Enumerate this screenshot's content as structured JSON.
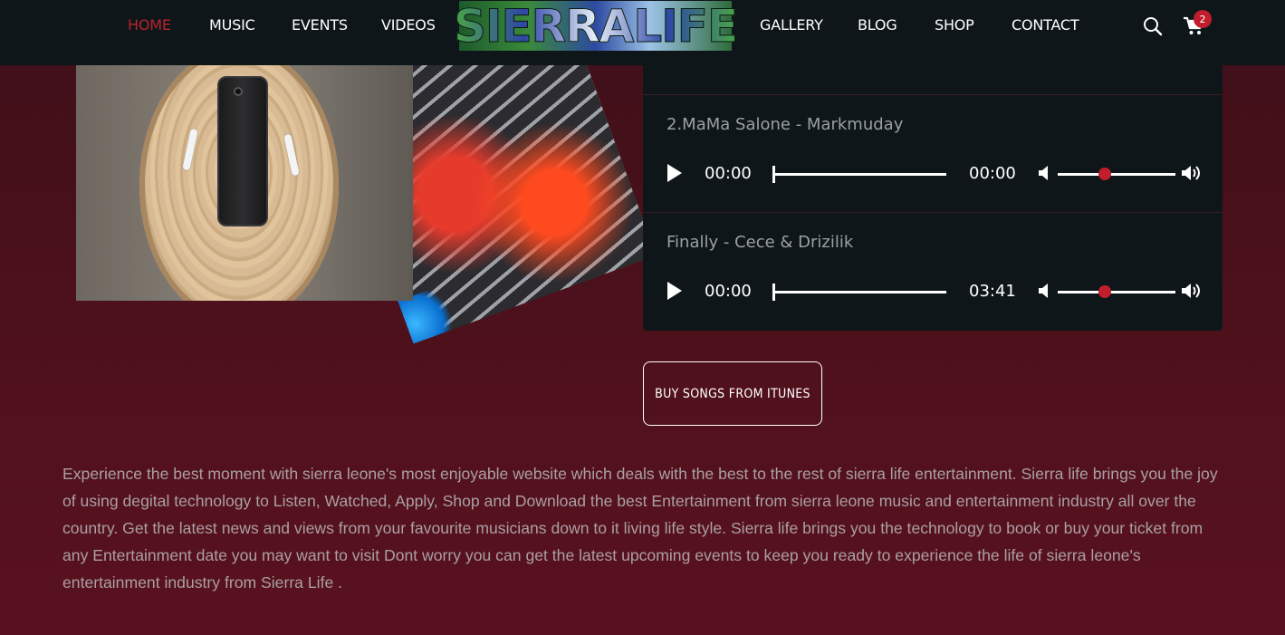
{
  "header": {
    "nav_left": [
      "HOME",
      "MUSIC",
      "EVENTS",
      "VIDEOS"
    ],
    "nav_right": [
      "GALLERY",
      "BLOG",
      "SHOP",
      "CONTACT"
    ],
    "logo_text": "SIERRALIFE",
    "cart_count": "2",
    "active_color": "#b8232f"
  },
  "playlist": {
    "tracks": [
      {
        "title": "2.MaMa Salone - Markmuday",
        "current": "00:00",
        "duration": "00:00",
        "volume": 0.4
      },
      {
        "title": "Finally - Cece & Drizilik",
        "current": "00:00",
        "duration": "03:41",
        "volume": 0.4
      }
    ]
  },
  "cta": {
    "label": "BUY SONGS FROM ITUNES"
  },
  "description": "Experience the best moment with sierra leone's most enjoyable website which deals with the best to the rest of sierra life entertainment. Sierra life brings you the joy of using degital technology to Listen, Watched, Apply, Shop and Download the best Entertainment from sierra leone music and entertainment industry all over the country. Get the latest news and views from your favourite musicians down to it living life style. Sierra life brings you the technology to book or buy your ticket from any Entertainment date you may want to visit Dont worry you can get the latest upcoming events to keep you ready to experience the life of sierra leone's entertainment industry from Sierra Life .",
  "icons": {
    "search": "search-icon",
    "cart": "cart-icon",
    "play": "play-icon",
    "mute": "volume-mute-icon",
    "volume": "volume-up-icon"
  },
  "colors": {
    "header_bg": "#0f1619",
    "accent": "#c01e2d",
    "page_bg": "#4e111c"
  }
}
